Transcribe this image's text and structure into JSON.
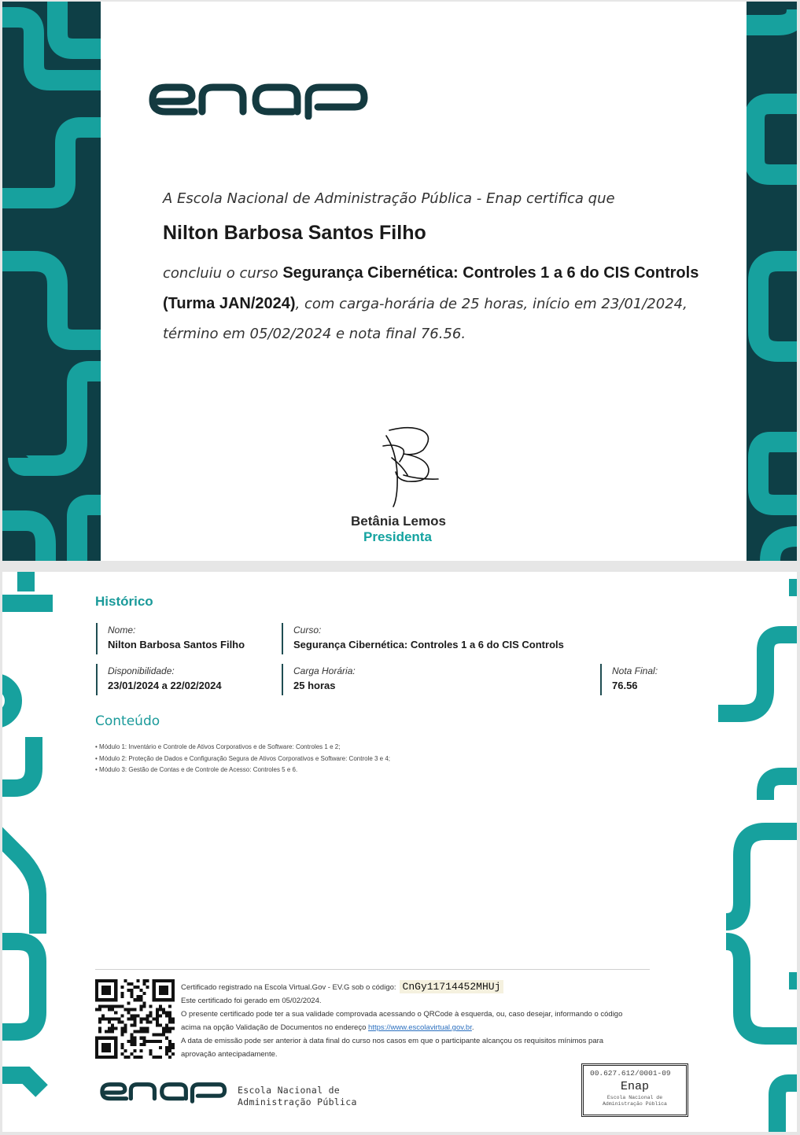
{
  "colors": {
    "teal": "#17a19e",
    "dark_teal": "#0e3f46",
    "logo_dark": "#143a40",
    "accent_text": "#1a9a9a"
  },
  "page1": {
    "logo_text": "enap",
    "intro": "A Escola Nacional de Administração Pública - Enap certifica que",
    "recipient_name": "Nilton Barbosa Santos Filho",
    "course_prefix": "concluiu o curso ",
    "course_name": "Segurança Cibernética: Controles 1 a 6 do CIS Controls (Turma JAN/2024)",
    "course_suffix": ", com carga-horária de 25 horas, início em 23/01/2024, término em 05/02/2024 e nota final 76.56.",
    "signature_icon": "handwritten-signature",
    "signatory_name": "Betânia Lemos",
    "signatory_role": "Presidenta"
  },
  "page2": {
    "history_title": "Histórico",
    "fields": {
      "name_label": "Nome:",
      "name_value": "Nilton Barbosa Santos Filho",
      "course_label": "Curso:",
      "course_value": "Segurança Cibernética: Controles 1 a 6 do CIS Controls",
      "availability_label": "Disponibilidade:",
      "availability_value": "23/01/2024 a 22/02/2024",
      "workload_label": "Carga Horária:",
      "workload_value": "25 horas",
      "grade_label": "Nota Final:",
      "grade_value": "76.56"
    },
    "content_title": "Conteúdo",
    "modules": [
      "• Módulo 1: Inventário e Controle de Ativos Corporativos e de Software: Controles 1 e 2;",
      "• Módulo 2: Proteção de Dados e Configuração Segura de Ativos Corporativos e Software: Controle 3 e 4;",
      "• Módulo 3: Gestão de Contas e de Controle de Acesso: Controles 5 e 6."
    ],
    "footer": {
      "registered_text": "Certificado registrado na Escola Virtual.Gov - EV.G sob o código:",
      "code": "CnGy11714452MHUj",
      "generated_text": "Este certificado foi gerado em 05/02/2024.",
      "validity_text": "O presente certificado pode ter a sua validade comprovada acessando o QRCode à esquerda, ou, caso desejar, informando o código acima na opção Validação de Documentos no endereço ",
      "link_text": "https://www.escolavirtual.gov.br",
      "validity_end": ".",
      "emission_text": "A data de emissão pode ser anterior à data final do curso nos casos em que o participante alcançou os requisitos mínimos para aprovação antecipadamente.",
      "qr_icon": "qr-code"
    },
    "footer_logo_text": "enap",
    "school_name_line1": "Escola Nacional de",
    "school_name_line2": "Administração Pública",
    "stamp": {
      "cnpj": "00.627.612/0001-09",
      "name": "Enap",
      "line1": "Escola Nacional de",
      "line2": "Administração Pública"
    }
  }
}
